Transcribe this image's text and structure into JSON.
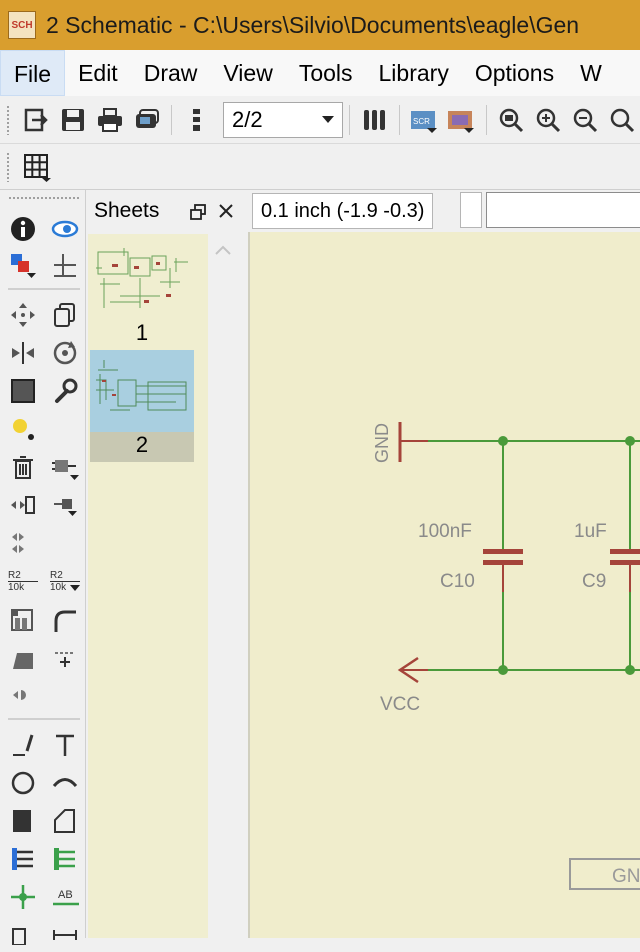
{
  "window": {
    "app_icon_label": "SCH",
    "title": "2 Schematic - C:\\Users\\Silvio\\Documents\\eagle\\Gen"
  },
  "menu": {
    "items": [
      {
        "label": "File"
      },
      {
        "label": "Edit"
      },
      {
        "label": "Draw"
      },
      {
        "label": "View"
      },
      {
        "label": "Tools"
      },
      {
        "label": "Library"
      },
      {
        "label": "Options"
      },
      {
        "label": "W"
      }
    ]
  },
  "toolbar": {
    "sheet_selector_value": "2/2",
    "icons": [
      "open-icon",
      "save-icon",
      "print-icon",
      "cam-icon",
      "sheet-icon",
      "sheet-dropdown",
      "pin-icon",
      "scr-icon",
      "ulp-icon",
      "zoom-fit-icon",
      "zoom-in-icon",
      "zoom-out-icon",
      "zoom-select-icon"
    ]
  },
  "toolbar2": {
    "icons": [
      "grid-icon"
    ]
  },
  "left_toolbar": {
    "icons": [
      "info-icon",
      "show-icon",
      "display-layers-icon",
      "mark-icon",
      "move-icon",
      "copy-icon",
      "mirror-icon",
      "rotate-icon",
      "group-icon",
      "change-icon",
      "paste-icon",
      "delete-icon",
      "add-icon",
      "replace-icon",
      "name-icon",
      "value-icon",
      "smash-icon",
      "miter-icon",
      "split-icon",
      "invoke-icon",
      "gateswap-icon",
      "wire-icon",
      "text-icon",
      "circle-icon",
      "arc-icon",
      "rect-icon",
      "polygon-icon",
      "bus-icon",
      "net-icon",
      "junction-icon",
      "label-icon"
    ],
    "name_tool_label": "R2",
    "name_tool_sub": "10k",
    "value_tool_label": "R2",
    "value_tool_sub": "10k"
  },
  "sheets_panel": {
    "title": "Sheets",
    "sheets": [
      {
        "number": "1",
        "selected": false
      },
      {
        "number": "2",
        "selected": true
      }
    ]
  },
  "status": {
    "coordinates": "0.1 inch (-1.9 -0.3)",
    "command_value": ""
  },
  "schematic": {
    "gnd_label": "GND",
    "vcc_label": "VCC",
    "capacitors": [
      {
        "name": "C10",
        "value": "100nF"
      },
      {
        "name": "C9",
        "value": "1uF"
      }
    ],
    "frame_text": "GN"
  },
  "colors": {
    "titlebar": "#d99e2e",
    "canvas": "#f0edcc",
    "wire": "#4a9a3a",
    "component": "#a5443a",
    "label_text": "#8a8a8a"
  }
}
